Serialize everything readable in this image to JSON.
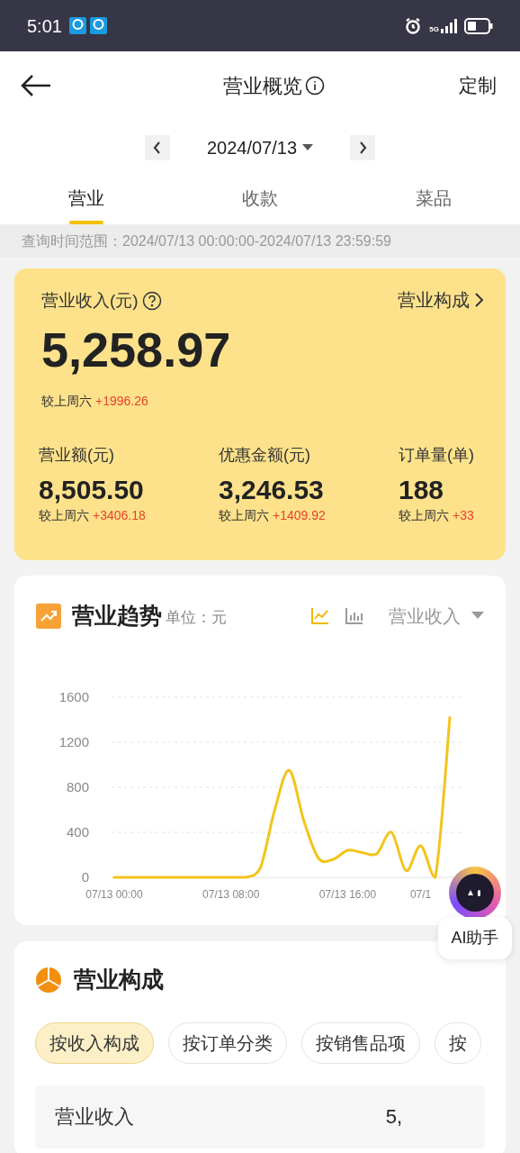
{
  "status_bar": {
    "time": "5:01",
    "network": "5G"
  },
  "header": {
    "title": "营业概览",
    "action": "定制"
  },
  "date_picker": {
    "date": "2024/07/13"
  },
  "tabs": [
    {
      "label": "营业",
      "selected": true
    },
    {
      "label": "收款",
      "selected": false
    },
    {
      "label": "菜品",
      "selected": false
    }
  ],
  "query_range": "查询时间范围：2024/07/13 00:00:00-2024/07/13 23:59:59",
  "summary": {
    "title": "营业收入(元)",
    "link": "营业构成",
    "value": "5,258.97",
    "compare_label": "较上周六",
    "compare_value": "+1996.26",
    "metrics": [
      {
        "label": "营业额(元)",
        "value": "8,505.50",
        "compare_label": "较上周六",
        "compare_value": "+3406.18"
      },
      {
        "label": "优惠金额(元)",
        "value": "3,246.53",
        "compare_label": "较上周六",
        "compare_value": "+1409.92"
      },
      {
        "label": "订单量(单)",
        "value": "188",
        "compare_label": "较上周六",
        "compare_value": "+33"
      }
    ]
  },
  "trend": {
    "title": "营业趋势",
    "unit": "单位：元",
    "chart_types": [
      {
        "kind": "line",
        "selected": true
      },
      {
        "kind": "bar",
        "selected": false
      }
    ],
    "chart_data": {
      "type": "line",
      "categories": [
        "07/13 00:00",
        null,
        null,
        null,
        null,
        null,
        null,
        null,
        "07/13 08:00",
        null,
        null,
        null,
        null,
        null,
        null,
        null,
        "07/13 16:00",
        null,
        null,
        null,
        null,
        "07/1",
        null,
        null
      ],
      "series": [
        {
          "name": "营业收入",
          "color": "#f2c41c",
          "values": [
            0,
            0,
            0,
            0,
            0,
            0,
            0,
            0,
            0,
            0,
            80,
            600,
            950,
            500,
            170,
            160,
            240,
            220,
            210,
            400,
            60,
            280,
            0,
            1420
          ]
        }
      ],
      "ylim": [
        0,
        1600
      ],
      "yticks": [
        0,
        400,
        800,
        1200,
        1600
      ],
      "grid": true
    }
  },
  "ai_button": {
    "label": "AI助手"
  },
  "composition": {
    "title": "营业构成",
    "filters": [
      {
        "label": "按收入构成",
        "selected": true
      },
      {
        "label": "按订单分类",
        "selected": false
      },
      {
        "label": "按销售品项",
        "selected": false
      },
      {
        "label": "按",
        "selected": false
      }
    ],
    "rows": [
      {
        "label": "营业收入",
        "value": "5,"
      }
    ]
  }
}
